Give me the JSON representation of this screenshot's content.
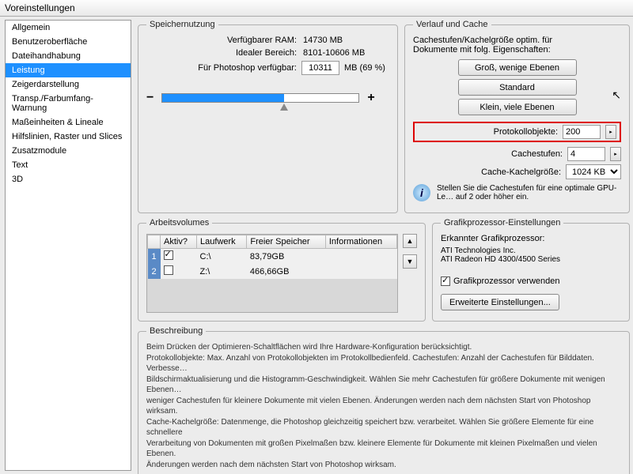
{
  "window": {
    "title": "Voreinstellungen"
  },
  "sidebar": {
    "items": [
      {
        "label": "Allgemein"
      },
      {
        "label": "Benutzeroberfläche"
      },
      {
        "label": "Dateihandhabung"
      },
      {
        "label": "Leistung"
      },
      {
        "label": "Zeigerdarstellung"
      },
      {
        "label": "Transp./Farbumfang-Warnung"
      },
      {
        "label": "Maßeinheiten & Lineale"
      },
      {
        "label": "Hilfslinien, Raster und Slices"
      },
      {
        "label": "Zusatzmodule"
      },
      {
        "label": "Text"
      },
      {
        "label": "3D"
      }
    ],
    "selected": 3
  },
  "memory": {
    "legend": "Speichernutzung",
    "available_label": "Verfügbarer RAM:",
    "available_value": "14730 MB",
    "ideal_label": "Idealer Bereich:",
    "ideal_value": "8101-10606 MB",
    "for_ps_label": "Für Photoshop verfügbar:",
    "for_ps_value": "10311",
    "for_ps_suffix": "MB (69 %)",
    "minus": "−",
    "plus": "+"
  },
  "history": {
    "legend": "Verlauf und Cache",
    "intro1": "Cachestufen/Kachelgröße optim. für",
    "intro2": "Dokumente mit folg. Eigenschaften:",
    "btn_large": "Groß, wenige Ebenen",
    "btn_default": "Standard",
    "btn_small": "Klein, viele Ebenen",
    "proto_label": "Protokollobjekte:",
    "proto_value": "200",
    "cache_label": "Cachestufen:",
    "cache_value": "4",
    "tile_label": "Cache-Kachelgröße:",
    "tile_value": "1024 KB",
    "info": "Stellen Sie die Cachestufen für eine optimale GPU-Le… auf 2 oder höher ein."
  },
  "scratch": {
    "legend": "Arbeitsvolumes",
    "cols": {
      "active": "Aktiv?",
      "drive": "Laufwerk",
      "free": "Freier Speicher",
      "info": "Informationen"
    },
    "rows": [
      {
        "n": "1",
        "active": true,
        "drive": "C:\\",
        "free": "83,79GB",
        "info": ""
      },
      {
        "n": "2",
        "active": false,
        "drive": "Z:\\",
        "free": "466,66GB",
        "info": ""
      }
    ]
  },
  "gpu": {
    "legend": "Grafikprozessor-Einstellungen",
    "detected_label": "Erkannter Grafikprozessor:",
    "vendor": "ATI Technologies Inc.",
    "model": "ATI Radeon HD 4300/4500 Series",
    "use_label": "Grafikprozessor verwenden",
    "advanced": "Erweiterte Einstellungen..."
  },
  "desc": {
    "legend": "Beschreibung",
    "text": "Beim Drücken der Optimieren-Schaltflächen wird Ihre Hardware-Konfiguration berücksichtigt.\nProtokollobjekte: Max. Anzahl von Protokollobjekten im Protokollbedienfeld. Cachestufen: Anzahl der Cachestufen für Bilddaten. Verbesse…\nBildschirmaktualisierung und die Histogramm-Geschwindigkeit. Wählen Sie mehr Cachestufen für größere Dokumente mit wenigen Ebenen…\nweniger Cachestufen für kleinere Dokumente mit vielen Ebenen. Änderungen werden nach dem nächsten Start von Photoshop wirksam.\nCache-Kachelgröße: Datenmenge, die Photoshop gleichzeitig speichert bzw. verarbeitet. Wählen Sie größere Elemente für eine schnellere\nVerarbeitung von Dokumenten mit großen Pixelmaßen bzw. kleinere Elemente für Dokumente mit kleinen Pixelmaßen und vielen Ebenen.\nÄnderungen werden nach dem nächsten Start von Photoshop wirksam."
  }
}
